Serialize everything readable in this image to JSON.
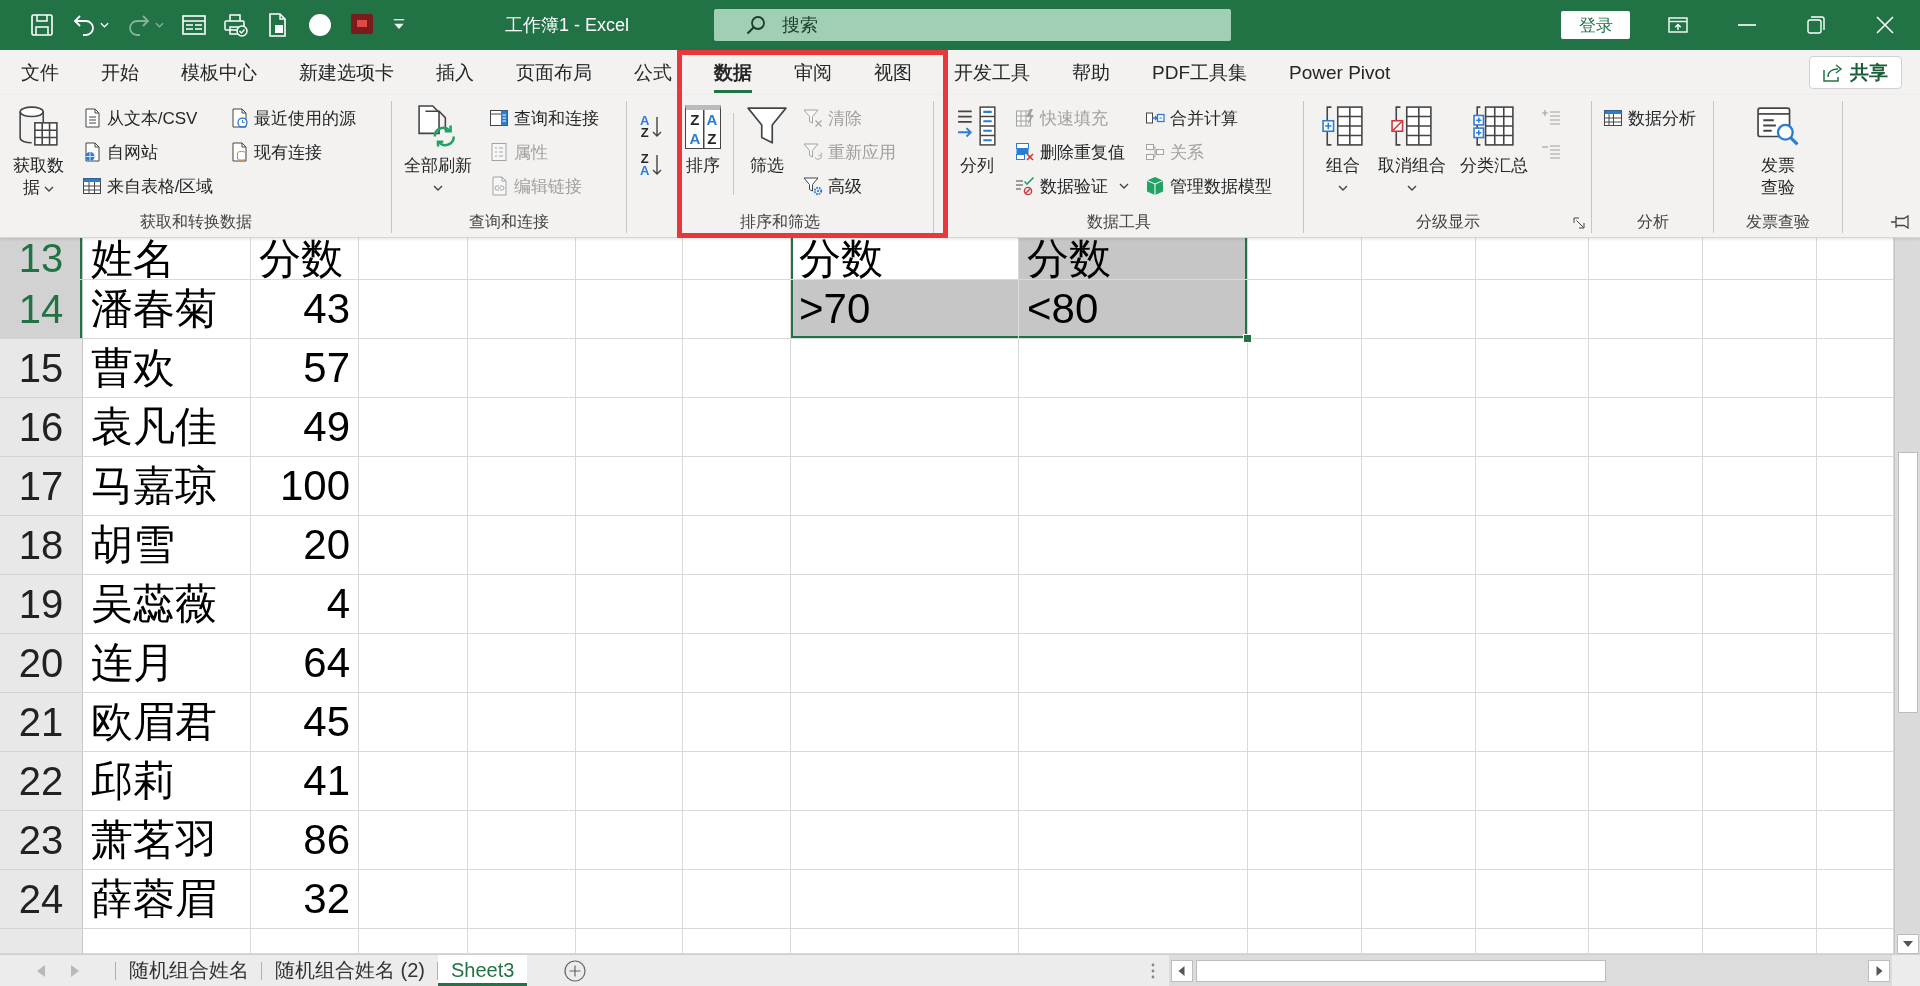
{
  "title_bar": {
    "quick_access": [
      {
        "disabled": false,
        "dropdown": false
      },
      {
        "disabled": false,
        "dropdown": true
      },
      {
        "disabled": true,
        "dropdown": true
      },
      {
        "disabled": false,
        "dropdown": false
      },
      {
        "disabled": false,
        "dropdown": false
      },
      {
        "disabled": false,
        "dropdown": false
      },
      {
        "disabled": false,
        "dropdown": false
      },
      {
        "disabled": false,
        "dropdown": false
      },
      {
        "disabled": false,
        "dropdown": false
      }
    ],
    "title": "工作簿1 - Excel",
    "search": {
      "placeholder": "搜索"
    },
    "login_button": "登录"
  },
  "ribbon_tabs": [
    {
      "label": "文件",
      "selected": false
    },
    {
      "label": "开始",
      "selected": false
    },
    {
      "label": "模板中心",
      "selected": false
    },
    {
      "label": "新建选项卡",
      "selected": false
    },
    {
      "label": "插入",
      "selected": false
    },
    {
      "label": "页面布局",
      "selected": false
    },
    {
      "label": "公式",
      "selected": false
    },
    {
      "label": "数据",
      "selected": true
    },
    {
      "label": "审阅",
      "selected": false
    },
    {
      "label": "视图",
      "selected": false
    },
    {
      "label": "开发工具",
      "selected": false
    },
    {
      "label": "帮助",
      "selected": false
    },
    {
      "label": "PDF工具集",
      "selected": false
    },
    {
      "label": "Power Pivot",
      "selected": false
    }
  ],
  "share_button": "共享",
  "ribbon_groups": [
    {
      "label": "获取和转换数据",
      "launcher": false,
      "controls": [
        {
          "kind": "large",
          "label": "获取数据",
          "disabled": false,
          "dropdown": true
        },
        {
          "kind": "stack",
          "items": [
            {
              "label": "从文本/CSV",
              "disabled": false,
              "dropdown": false
            },
            {
              "label": "自网站",
              "disabled": false,
              "dropdown": false
            },
            {
              "label": "来自表格/区域",
              "disabled": false,
              "dropdown": false
            }
          ]
        },
        {
          "kind": "stack",
          "items": [
            {
              "label": "最近使用的源",
              "disabled": false,
              "dropdown": false
            },
            {
              "label": "现有连接",
              "disabled": false,
              "dropdown": false
            }
          ]
        }
      ]
    },
    {
      "label": "查询和连接",
      "launcher": false,
      "controls": [
        {
          "kind": "large",
          "label": "全部刷新",
          "disabled": false,
          "dropdown": true
        },
        {
          "kind": "stack",
          "items": [
            {
              "label": "查询和连接",
              "disabled": false,
              "dropdown": false
            },
            {
              "label": "属性",
              "disabled": true,
              "dropdown": false
            },
            {
              "label": "编辑链接",
              "disabled": true,
              "dropdown": false
            }
          ]
        }
      ]
    },
    {
      "label": "排序和筛选",
      "launcher": false,
      "controls": [
        {
          "kind": "sort_stack",
          "items": [
            {
              "letters": [
                "A",
                "Z"
              ],
              "kind": "ascending",
              "disabled": false
            },
            {
              "letters": [
                "Z",
                "A"
              ],
              "kind": "descending",
              "disabled": false
            }
          ]
        },
        {
          "kind": "large",
          "label": "排序",
          "icon_letters": [
            "Z",
            "A",
            "A",
            "Z"
          ],
          "disabled": false,
          "dropdown": false
        },
        {
          "kind": "separator"
        },
        {
          "kind": "large",
          "label": "筛选",
          "disabled": false,
          "dropdown": false
        },
        {
          "kind": "stack",
          "items": [
            {
              "label": "清除",
              "disabled": true,
              "dropdown": false
            },
            {
              "label": "重新应用",
              "disabled": true,
              "dropdown": false
            },
            {
              "label": "高级",
              "disabled": false,
              "dropdown": false
            }
          ]
        }
      ]
    },
    {
      "label": "数据工具",
      "launcher": false,
      "controls": [
        {
          "kind": "large",
          "label": "分列",
          "disabled": false,
          "dropdown": false
        },
        {
          "kind": "stack",
          "items": [
            {
              "label": "快速填充",
              "disabled": true,
              "dropdown": false
            },
            {
              "label": "删除重复值",
              "disabled": false,
              "dropdown": false
            },
            {
              "label": "数据验证",
              "disabled": false,
              "dropdown": true
            }
          ]
        },
        {
          "kind": "stack",
          "items": [
            {
              "label": "合并计算",
              "disabled": false,
              "dropdown": false
            },
            {
              "label": "关系",
              "disabled": true,
              "dropdown": false
            },
            {
              "label": "管理数据模型",
              "disabled": false,
              "dropdown": false
            }
          ]
        }
      ]
    },
    {
      "label": "分级显示",
      "launcher": true,
      "controls": [
        {
          "kind": "large",
          "label": "组合",
          "disabled": false,
          "dropdown": true
        },
        {
          "kind": "large",
          "label": "取消组合",
          "disabled": false,
          "dropdown": true
        },
        {
          "kind": "large",
          "label": "分类汇总",
          "disabled": false,
          "dropdown": false
        },
        {
          "kind": "stack",
          "items": [
            {
              "disabled": true,
              "dropdown": false
            },
            {
              "disabled": true,
              "dropdown": false
            }
          ]
        }
      ]
    },
    {
      "label": "分析",
      "launcher": false,
      "controls": [
        {
          "kind": "stack",
          "items": [
            {
              "label": "数据分析",
              "disabled": false,
              "dropdown": false
            }
          ]
        }
      ]
    },
    {
      "label": "发票查验",
      "launcher": false,
      "controls": [
        {
          "kind": "large",
          "label": "发票查验",
          "disabled": false,
          "dropdown": false
        }
      ]
    }
  ],
  "sheet": {
    "rows": [
      {
        "number": "13",
        "selected": true,
        "kind": "header",
        "column_1": "姓名",
        "column_2": "分数",
        "criteria": [
          {
            "text": "分数",
            "selected": true,
            "active": true
          },
          {
            "text": "分数",
            "selected": true,
            "active": false
          }
        ]
      },
      {
        "number": "14",
        "selected": true,
        "kind": "data",
        "column_1": "潘春菊",
        "column_2": "43",
        "criteria": [
          {
            "text": ">70",
            "selected": true,
            "active": false
          },
          {
            "text": "<80",
            "selected": true,
            "active": false
          }
        ]
      },
      {
        "number": "15",
        "selected": false,
        "kind": "data",
        "column_1": "曹欢",
        "column_2": "57"
      },
      {
        "number": "16",
        "selected": false,
        "kind": "data",
        "column_1": "袁凡佳",
        "column_2": "49"
      },
      {
        "number": "17",
        "selected": false,
        "kind": "data",
        "column_1": "马嘉琼",
        "column_2": "100"
      },
      {
        "number": "18",
        "selected": false,
        "kind": "data",
        "column_1": "胡雪",
        "column_2": "20"
      },
      {
        "number": "19",
        "selected": false,
        "kind": "data",
        "column_1": "吴蕊薇",
        "column_2": "4"
      },
      {
        "number": "20",
        "selected": false,
        "kind": "data",
        "column_1": "连月",
        "column_2": "64"
      },
      {
        "number": "21",
        "selected": false,
        "kind": "data",
        "column_1": "欧眉君",
        "column_2": "45"
      },
      {
        "number": "22",
        "selected": false,
        "kind": "data",
        "column_1": "邱莉",
        "column_2": "41"
      },
      {
        "number": "23",
        "selected": false,
        "kind": "data",
        "column_1": "萧茗羽",
        "column_2": "86"
      },
      {
        "number": "24",
        "selected": false,
        "kind": "data",
        "column_1": "薛蓉眉",
        "column_2": "32"
      }
    ]
  },
  "sheet_tabs": [
    {
      "label": "随机组合姓名",
      "selected": false
    },
    {
      "label": "随机组合姓名 (2)",
      "selected": false
    },
    {
      "label": "Sheet3",
      "selected": true
    }
  ]
}
